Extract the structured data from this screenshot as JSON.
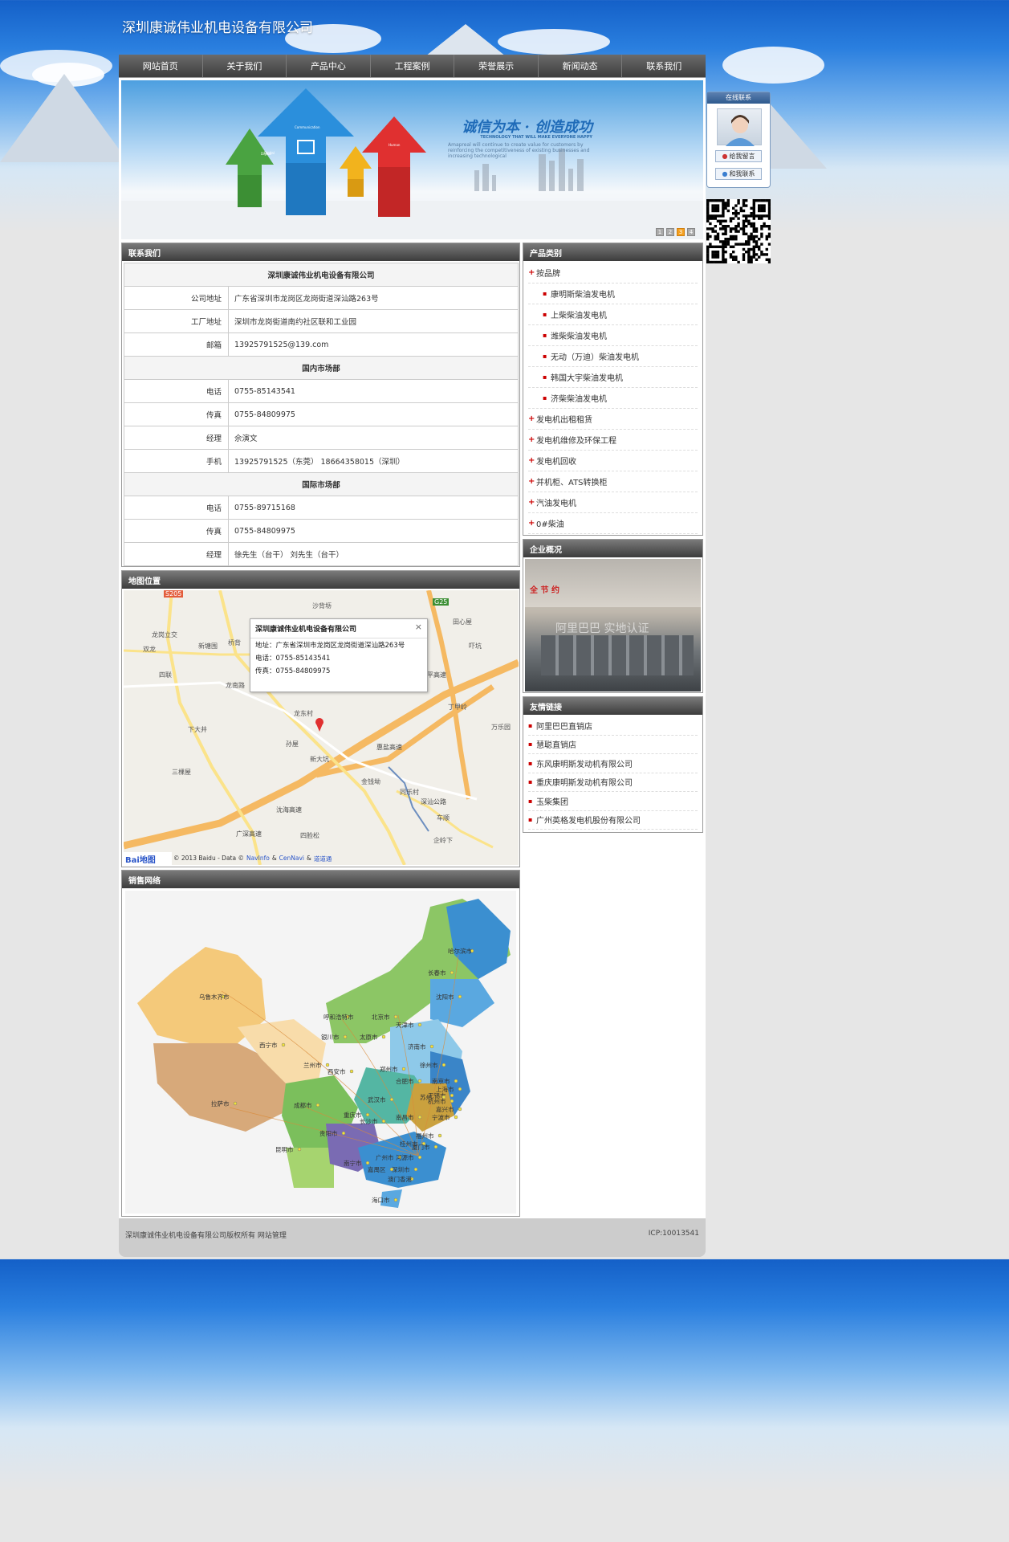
{
  "site": {
    "title": "深圳康诚伟业机电设备有限公司"
  },
  "nav": [
    "网站首页",
    "关于我们",
    "产品中心",
    "工程案例",
    "荣誉展示",
    "新闻动态",
    "联系我们"
  ],
  "banner": {
    "slogan": "诚信为本 · 创造成功",
    "slogan_en": "TECHNOLOGY THAT WILL MAKE EVERYONE HAPPY",
    "slogan_sub": "Amapreal will continue to create value for customers by reinforcing the competitiveness of existing businesses and increasing technological",
    "arrow_labels": [
      "Digital",
      "Communication",
      "Human"
    ],
    "dots": [
      "1",
      "2",
      "3",
      "4"
    ],
    "active_dot": 3
  },
  "contact": {
    "heading": "联系我们",
    "company": "深圳康诚伟业机电设备有限公司",
    "rows_top": [
      {
        "k": "公司地址",
        "v": "广东省深圳市龙岗区龙岗街道深汕路263号"
      },
      {
        "k": "工厂地址",
        "v": "深圳市龙岗街道南约社区联和工业园"
      },
      {
        "k": "邮箱",
        "v": "13925791525@139.com"
      }
    ],
    "domestic_title": "国内市场部",
    "domestic": [
      {
        "k": "电话",
        "v": "0755-85143541"
      },
      {
        "k": "传真",
        "v": "0755-84809975"
      },
      {
        "k": "经理",
        "v": "佘演文"
      },
      {
        "k": "手机",
        "v": "13925791525（东莞） 18664358015（深圳）"
      }
    ],
    "intl_title": "国际市场部",
    "intl": [
      {
        "k": "电话",
        "v": "0755-89715168"
      },
      {
        "k": "传真",
        "v": "0755-84809975"
      },
      {
        "k": "经理",
        "v": "徐先生（台干） 刘先生（台干）"
      }
    ]
  },
  "map": {
    "heading": "地图位置",
    "popup_title": "深圳康诚伟业机电设备有限公司",
    "popup_address": "地址：广东省深圳市龙岗区龙岗街道深汕路263号",
    "popup_phone": "电话：0755-85143541",
    "popup_fax": "传真：0755-84809975",
    "close": "×",
    "labels": [
      "龙岗立交",
      "双龙",
      "新塘围",
      "桥背",
      "沙背坜",
      "四联",
      "龙南路",
      "龙东村",
      "田心屋",
      "吓坑",
      "丁甲岭",
      "万乐园",
      "下大井",
      "孙屋",
      "新大坑",
      "三棵屋",
      "金钱坳",
      "同乐村",
      "四脸松",
      "车顺",
      "企岭下",
      "惠盐高速",
      "沈海高速",
      "广深高速",
      "清平高速",
      "深汕公路",
      "G25",
      "S205"
    ],
    "copyright_prefix": "© 2013 Baidu - Data ©",
    "copyright_navinfo": "NavInfo",
    "copyright_amp1": "&",
    "copyright_cennavi": "CenNavi",
    "copyright_amp2": "&",
    "copyright_daodao": "道道通",
    "logo": "Bai地图"
  },
  "sales": {
    "heading": "销售网络",
    "cities": [
      "哈尔滨市",
      "长春市",
      "沈阳市",
      "乌鲁木齐市",
      "呼和浩特市",
      "北京市",
      "天津市",
      "银川市",
      "太原市",
      "济南市",
      "西宁市",
      "兰州市",
      "西安市",
      "郑州市",
      "徐州市",
      "南京市",
      "合肥市",
      "上海市",
      "无锡市",
      "苏州",
      "杭州市",
      "嘉兴市",
      "宁波市",
      "武汉市",
      "拉萨市",
      "成都市",
      "重庆市",
      "长沙市",
      "南昌市",
      "贵阳市",
      "福州市",
      "桂州市",
      "厦门市",
      "昆明市",
      "南宁市",
      "广州市",
      "河源市",
      "深圳市",
      "嘉禺区",
      "澳门香港",
      "海口市"
    ]
  },
  "products": {
    "heading": "产品类别",
    "items": [
      {
        "label": "按品牌",
        "sub": false
      },
      {
        "label": "康明斯柴油发电机",
        "sub": true
      },
      {
        "label": "上柴柴油发电机",
        "sub": true
      },
      {
        "label": "潍柴柴油发电机",
        "sub": true
      },
      {
        "label": "无动（万迪）柴油发电机",
        "sub": true
      },
      {
        "label": "韩国大宇柴油发电机",
        "sub": true
      },
      {
        "label": "济柴柴油发电机",
        "sub": true
      },
      {
        "label": "发电机出租租赁",
        "sub": false
      },
      {
        "label": "发电机维修及环保工程",
        "sub": false
      },
      {
        "label": "发电机回收",
        "sub": false
      },
      {
        "label": "并机柜、ATS转换柜",
        "sub": false
      },
      {
        "label": "汽油发电机",
        "sub": false
      },
      {
        "label": "0#柴油",
        "sub": false
      }
    ]
  },
  "overview": {
    "heading": "企业概况",
    "watermark": "阿里巴巴 实地认证",
    "sign": "全 节 约"
  },
  "links": {
    "heading": "友情链接",
    "items": [
      "阿里巴巴直销店",
      "慧聪直销店",
      "东风康明斯发动机有限公司",
      "重庆康明斯发动机有限公司",
      "玉柴集团",
      "广州英格发电机股份有限公司"
    ]
  },
  "qq": {
    "head": "在线联系",
    "btn1": "给我留言",
    "btn2": "和我联系"
  },
  "footer": {
    "left": "深圳康诚伟业机电设备有限公司版权所有 网站管理",
    "right": "ICP:10013541"
  },
  "colors": {
    "accent_red": "#cc0000",
    "nav_bg": "#4a4a4a",
    "active_dot": "#f4a020"
  }
}
